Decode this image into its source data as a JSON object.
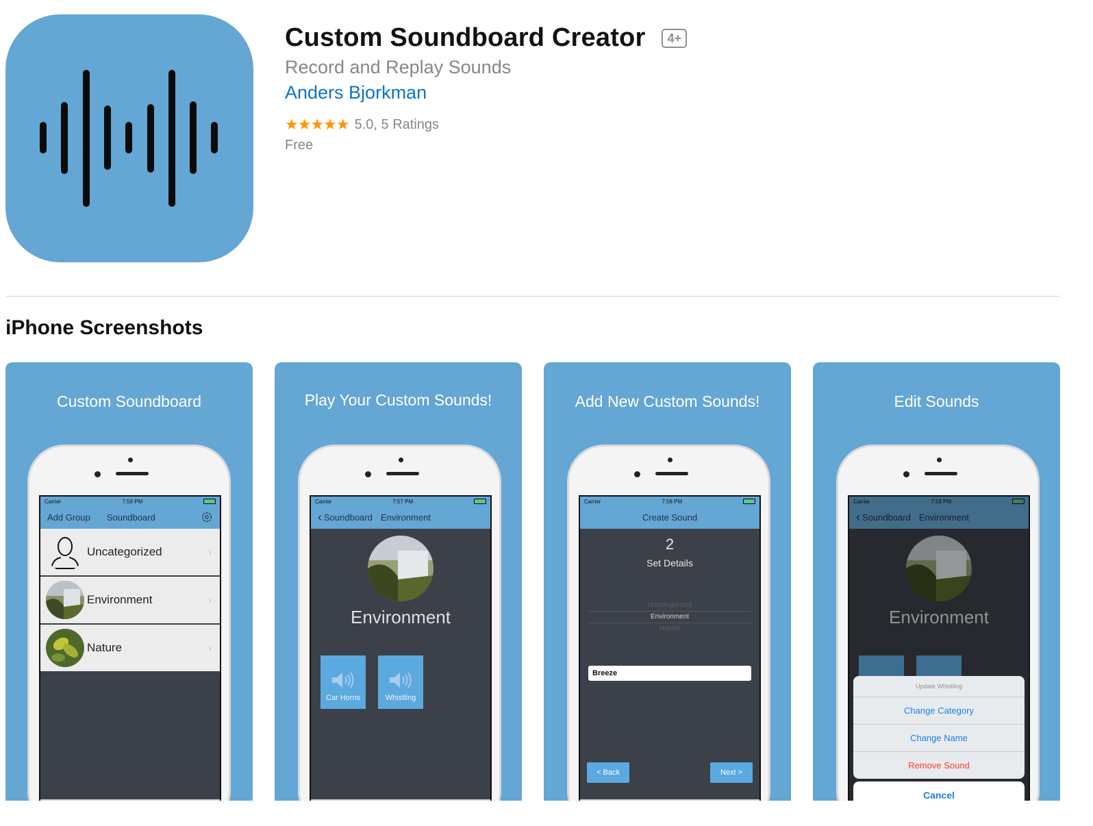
{
  "app": {
    "title": "Custom Soundboard Creator",
    "age_rating": "4+",
    "subtitle": "Record and Replay Sounds",
    "developer": "Anders Bjorkman",
    "stars": "★★★★★",
    "rating_text": "5.0, 5 Ratings",
    "price": "Free",
    "icon_color": "#64a6d4"
  },
  "section": {
    "title": "iPhone Screenshots"
  },
  "screenshots": [
    {
      "caption": "Custom Soundboard",
      "carrier": "Carrier",
      "time": "7:59 PM",
      "nav_left": "Add Group",
      "nav_title": "Soundboard",
      "rows": [
        {
          "label": "Uncategorized",
          "icon": "user-silhouette-icon"
        },
        {
          "label": "Environment",
          "icon": "waterfall-thumbnail"
        },
        {
          "label": "Nature",
          "icon": "leaf-thumbnail"
        }
      ]
    },
    {
      "caption": "Play Your Custom Sounds!",
      "carrier": "Carrier",
      "time": "7:57 PM",
      "back_label": "Soundboard",
      "nav_title": "Environment",
      "hero_label": "Environment",
      "tiles": [
        "Car Horns",
        "Whistling"
      ]
    },
    {
      "caption": "Add New Custom Sounds!",
      "carrier": "Carrier",
      "time": "7:58 PM",
      "nav_title": "Create Sound",
      "step_number": "2",
      "step_label": "Set Details",
      "picker_options": [
        "Uncategorized",
        "Environment",
        "Nature"
      ],
      "picker_selected": "Environment",
      "name_value": "Breeze",
      "back_button": "< Back",
      "next_button": "Next >"
    },
    {
      "caption": "Edit Sounds",
      "carrier": "Carrier",
      "time": "7:58 PM",
      "back_label": "Soundboard",
      "nav_title": "Environment",
      "hero_label": "Environment",
      "sheet_title": "Update Whistling",
      "sheet_items": [
        "Change Category",
        "Change Name"
      ],
      "sheet_destructive": "Remove Sound",
      "sheet_cancel": "Cancel"
    }
  ]
}
